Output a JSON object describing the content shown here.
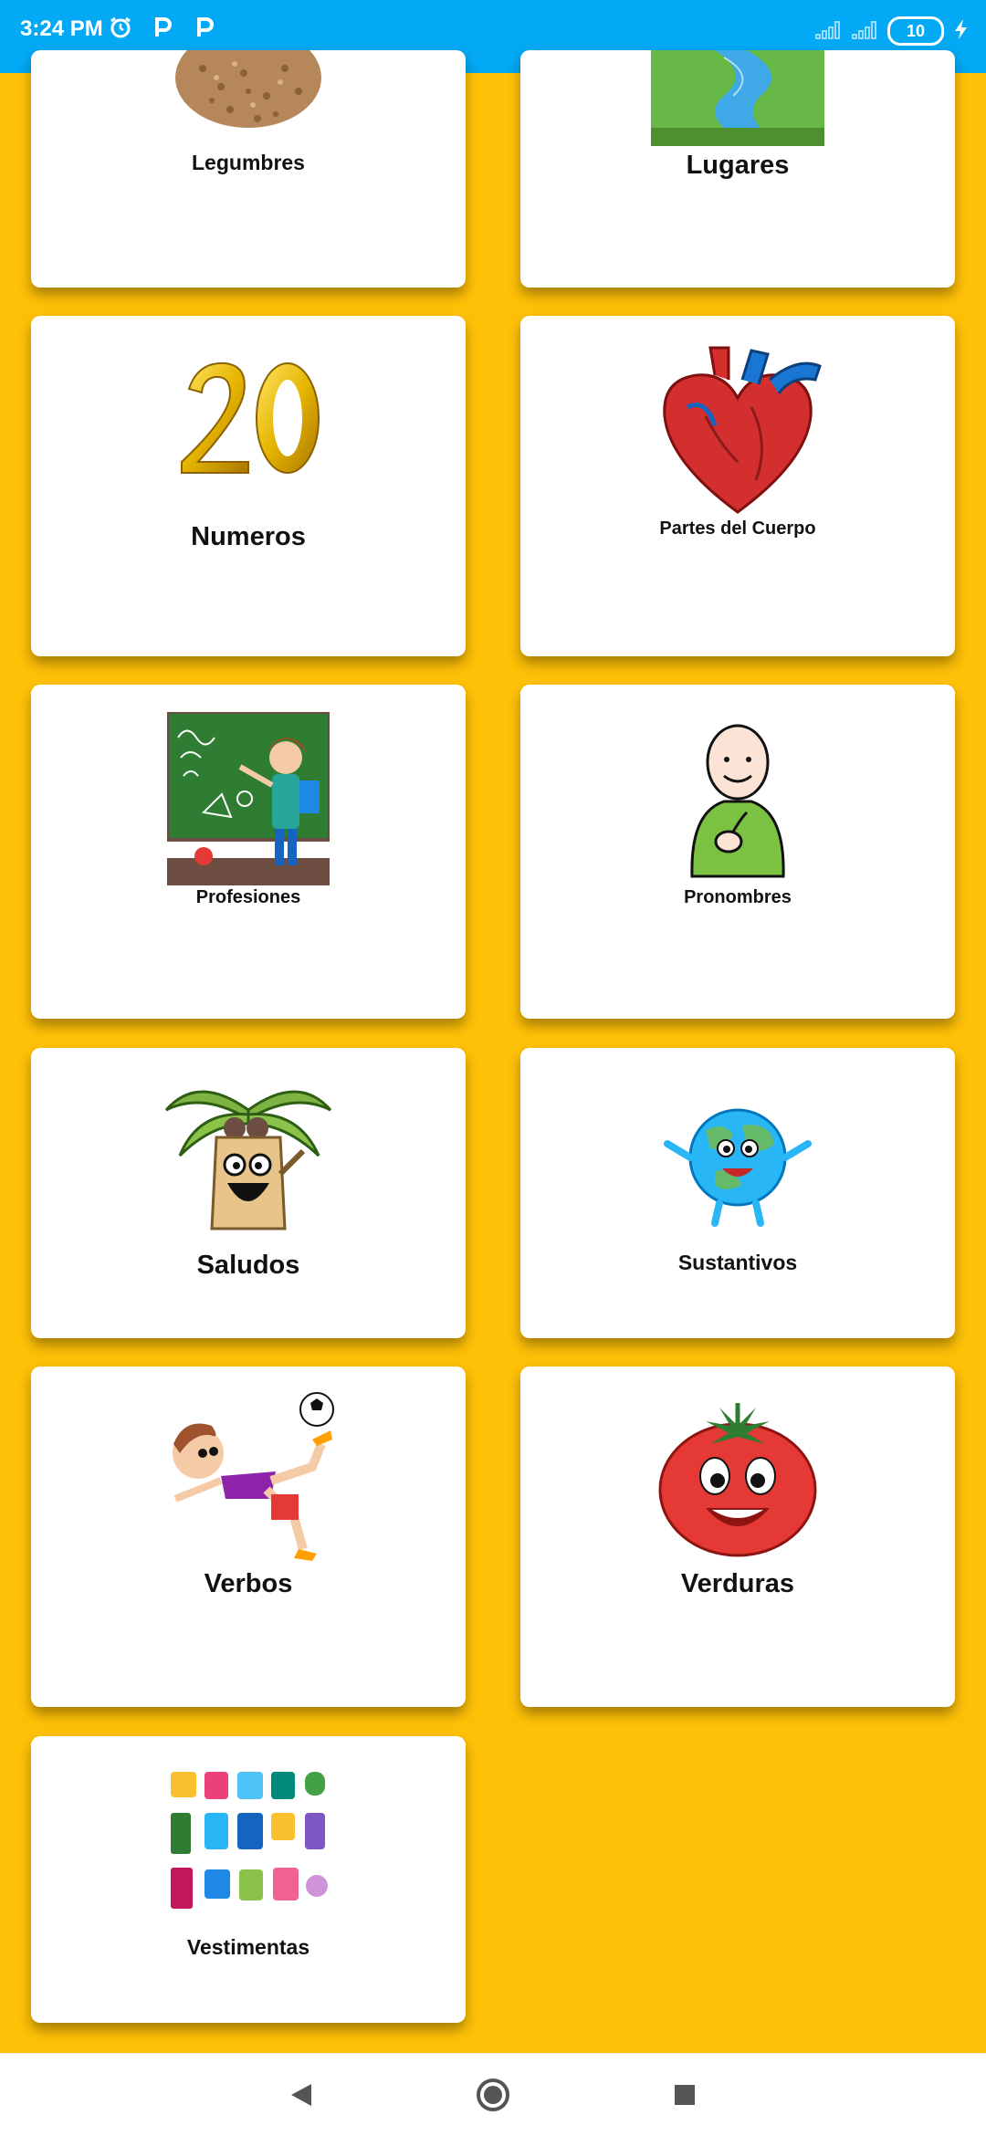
{
  "status_bar": {
    "time": "3:24 PM",
    "battery_level": "10",
    "icons": [
      "alarm-icon",
      "p-icon",
      "p-icon",
      "signal-icon",
      "signal-icon",
      "charging-icon"
    ]
  },
  "categories": [
    {
      "label": "Legumbres",
      "image": "lentils-icon"
    },
    {
      "label": "Lugares",
      "image": "river-landscape-icon"
    },
    {
      "label": "Numeros",
      "image": "number-20-icon"
    },
    {
      "label": "Partes del Cuerpo",
      "image": "heart-icon"
    },
    {
      "label": "Profesiones",
      "image": "teacher-icon"
    },
    {
      "label": "Pronombres",
      "image": "pointing-person-icon"
    },
    {
      "label": "Saludos",
      "image": "palm-tree-character-icon"
    },
    {
      "label": "Sustantivos",
      "image": "earth-character-icon"
    },
    {
      "label": "Verbos",
      "image": "soccer-kid-icon"
    },
    {
      "label": "Verduras",
      "image": "tomato-character-icon"
    },
    {
      "label": "Vestimentas",
      "image": "clothes-icon"
    }
  ],
  "colors": {
    "background": "#FFC107",
    "status_bar": "#03A9F4",
    "card": "#FFFFFF"
  }
}
